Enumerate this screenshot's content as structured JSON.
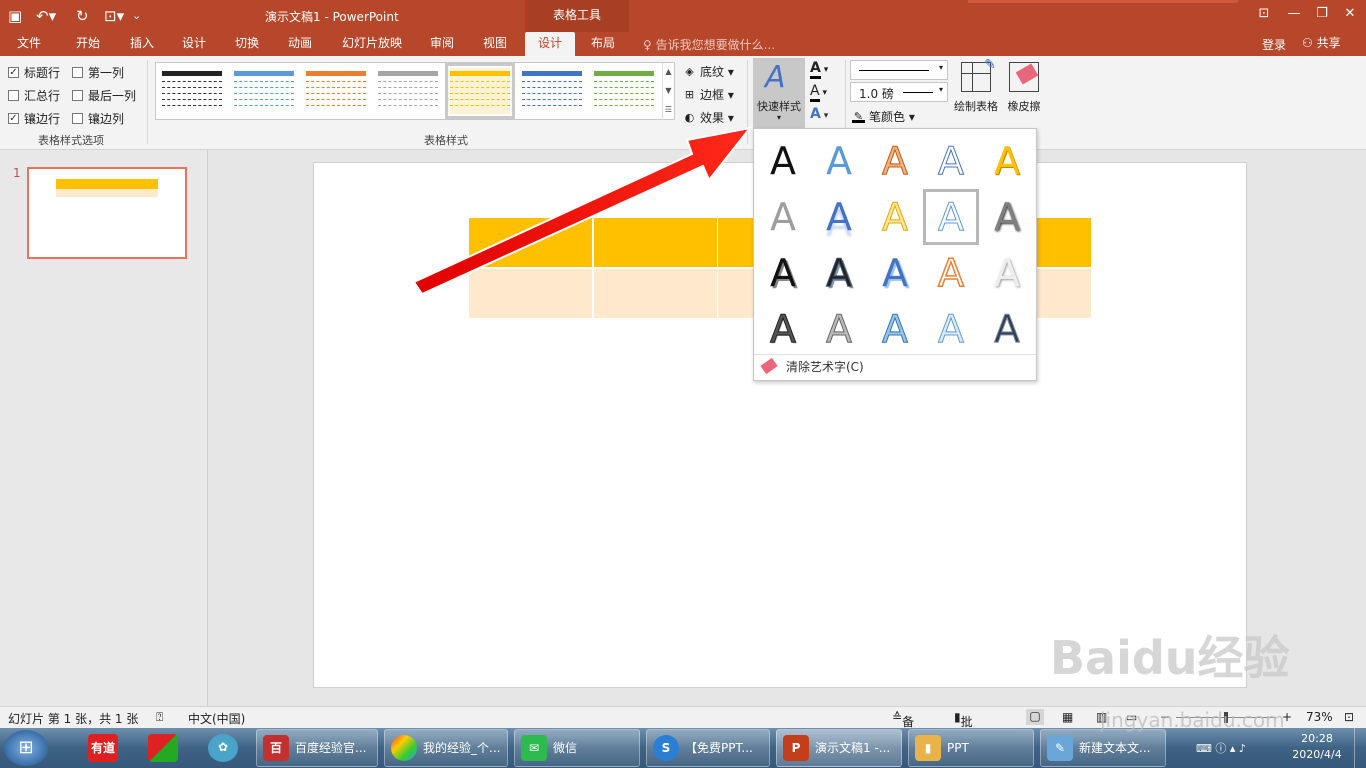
{
  "app": {
    "doc_title": "演示文稿1 - PowerPoint",
    "context_tools": "表格工具"
  },
  "tabs": [
    "文件",
    "开始",
    "插入",
    "设计",
    "切换",
    "动画",
    "幻灯片放映",
    "审阅",
    "视图",
    "设计",
    "布局"
  ],
  "tell_me": "告诉我您想要做什么...",
  "account": {
    "login": "登录",
    "share": "共享"
  },
  "table_style_options": {
    "items": [
      {
        "label": "标题行",
        "checked": true
      },
      {
        "label": "第一列",
        "checked": false
      },
      {
        "label": "汇总行",
        "checked": false
      },
      {
        "label": "最后一列",
        "checked": false
      },
      {
        "label": "镶边行",
        "checked": true
      },
      {
        "label": "镶边列",
        "checked": false
      }
    ],
    "group_label": "表格样式选项"
  },
  "table_styles": {
    "group_label": "表格样式",
    "swatches": [
      "#222222",
      "#5b9bd5",
      "#ed7d31",
      "#a5a5a5",
      "#ffc000",
      "#4472c4",
      "#70ad47"
    ],
    "selected_index": 4,
    "cmd_shading": "底纹",
    "cmd_borders": "边框",
    "cmd_effects": "效果"
  },
  "wordart": {
    "quick_styles": "快速样式",
    "pen_weight": "1.0 磅",
    "pen_color": "笔颜色",
    "draw_table": "绘制表格",
    "eraser": "橡皮擦",
    "letter": "A",
    "clear": "清除艺术字(C)",
    "selected_index": 8
  },
  "slide_panel": {
    "number": "1"
  },
  "table_colors": {
    "header": "#ffc000",
    "band": "#ffe9cc"
  },
  "status": {
    "slide_info": "幻灯片 第 1 张，共 1 张",
    "language": "中文(中国)",
    "notes": "备注",
    "comments": "批注",
    "zoom": "73%"
  },
  "taskbar": {
    "items": [
      {
        "label": "百度经验官..."
      },
      {
        "label": "我的经验_个..."
      },
      {
        "label": "微信"
      },
      {
        "label": "【免费PPT..."
      },
      {
        "label": "演示文稿1 -..."
      },
      {
        "label": "PPT"
      },
      {
        "label": "新建文本文..."
      }
    ],
    "pinned": [
      "有道"
    ],
    "time": "20:28",
    "date": "2020/4/4"
  },
  "watermark": {
    "brand": "Baidu经验",
    "url": "jingyan.baidu.com"
  }
}
